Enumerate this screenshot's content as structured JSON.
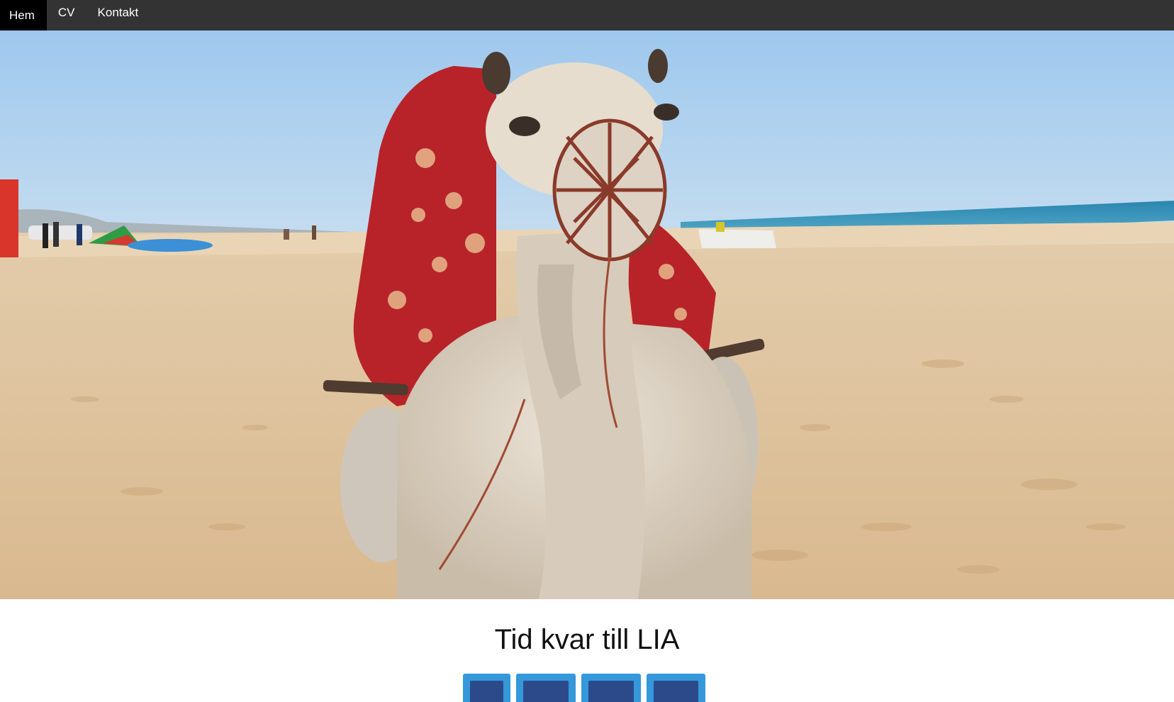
{
  "nav": {
    "items": [
      {
        "label": "Hem",
        "active": true
      },
      {
        "label": "CV",
        "active": false
      },
      {
        "label": "Kontakt",
        "active": false
      }
    ]
  },
  "hero": {
    "image_subject": "camel-on-beach"
  },
  "countdown": {
    "title": "Tid kvar till LIA",
    "boxes": [
      {
        "value": ""
      },
      {
        "value": ""
      },
      {
        "value": ""
      },
      {
        "value": ""
      }
    ]
  },
  "colors": {
    "nav_bg": "#333333",
    "nav_active": "#000000",
    "box_outer": "#3498db",
    "box_inner": "#2c4a8a"
  }
}
